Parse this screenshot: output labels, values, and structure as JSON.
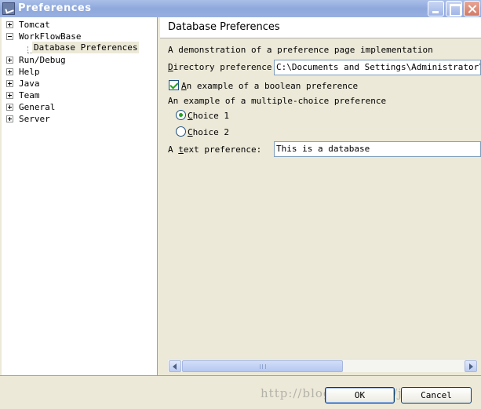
{
  "window": {
    "title": "Preferences",
    "icon": "preferences-app-icon"
  },
  "tree": {
    "items": [
      {
        "label": "Tomcat",
        "expander": "plus"
      },
      {
        "label": "WorkFlowBase",
        "expander": "minus"
      },
      {
        "label": "Database Preferences",
        "expander": "none",
        "selected": true
      },
      {
        "label": "Run/Debug",
        "expander": "plus"
      },
      {
        "label": "Help",
        "expander": "plus"
      },
      {
        "label": "Java",
        "expander": "plus"
      },
      {
        "label": "Team",
        "expander": "plus"
      },
      {
        "label": "General",
        "expander": "plus"
      },
      {
        "label": "Server",
        "expander": "plus"
      }
    ]
  },
  "page": {
    "heading": "Database Preferences",
    "description": "A demonstration of a preference page implementation",
    "directory_label_mnemonic": "D",
    "directory_label_rest": "irectory preference:",
    "directory_value": "C:\\Documents and Settings\\Administrator\\桌面",
    "boolean_mnemonic": "A",
    "boolean_rest": "n example of a boolean preference",
    "boolean_checked": true,
    "multiple_label": "An example of a multiple-choice preference",
    "choice1_mnemonic": "C",
    "choice1_rest": "hoice 1",
    "choice1_checked": true,
    "choice2_mnemonic": "C",
    "choice2_rest": "hoice 2",
    "choice2_checked": false,
    "text_label_prefix": "A ",
    "text_label_mnemonic": "t",
    "text_label_rest": "ext preference:",
    "text_value": "This is a database"
  },
  "buttons": {
    "ok": "OK",
    "cancel": "Cancel"
  },
  "watermark": "http://blog.csdn.net/jwwl",
  "colors": {
    "titlebar": "#8ea8dc",
    "dialog_bg": "#ece9d8",
    "check_green": "#21a121"
  }
}
